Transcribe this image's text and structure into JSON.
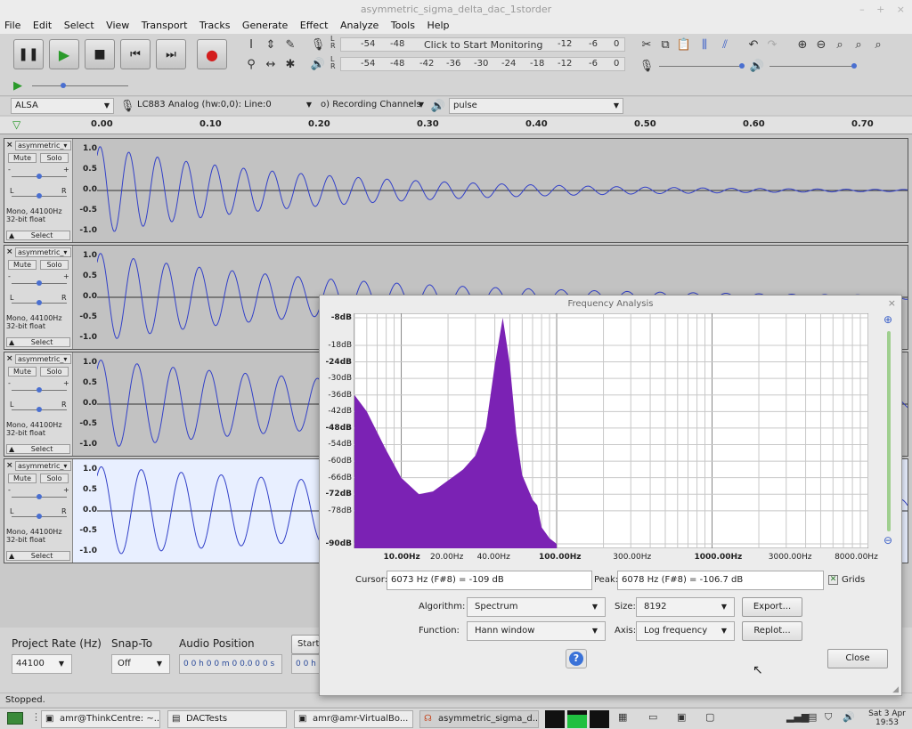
{
  "window": {
    "title": "asymmetric_sigma_delta_dac_1storder",
    "controls": [
      "–",
      "+",
      "×"
    ]
  },
  "menu": [
    "File",
    "Edit",
    "Select",
    "View",
    "Transport",
    "Tracks",
    "Generate",
    "Effect",
    "Analyze",
    "Tools",
    "Help"
  ],
  "meters": {
    "record_row": [
      "-54",
      "-48",
      "Click to Start Monitoring",
      "-12",
      "-6",
      "0"
    ],
    "play_row": [
      "-54",
      "-48",
      "-42",
      "-36",
      "-30",
      "-24",
      "-18",
      "-12",
      "-6",
      "0"
    ],
    "lr": [
      "L",
      "R"
    ]
  },
  "devices": {
    "host": "ALSA",
    "input": "LC883 Analog (hw:0,0): Line:0",
    "channels": "o) Recording Channels",
    "output": "pulse"
  },
  "ruler": {
    "ticks": [
      "0.00",
      "0.10",
      "0.20",
      "0.30",
      "0.40",
      "0.50",
      "0.60",
      "0.70"
    ]
  },
  "tracks": [
    {
      "name": "asymmetric_",
      "mute": "Mute",
      "solo": "Solo",
      "info1": "Mono, 44100Hz",
      "info2": "32-bit float",
      "select": "Select",
      "scale": [
        "1.0",
        "0.5",
        "0.0",
        "-0.5",
        "-1.0"
      ]
    },
    {
      "name": "asymmetric_",
      "mute": "Mute",
      "solo": "Solo",
      "info1": "Mono, 44100Hz",
      "info2": "32-bit float",
      "select": "Select",
      "scale": [
        "1.0",
        "0.5",
        "0.0",
        "-0.5",
        "-1.0"
      ]
    },
    {
      "name": "asymmetric_",
      "mute": "Mute",
      "solo": "Solo",
      "info1": "Mono, 44100Hz",
      "info2": "32-bit float",
      "select": "Select",
      "scale": [
        "1.0",
        "0.5",
        "0.0",
        "-0.5",
        "-1.0"
      ]
    },
    {
      "name": "asymmetric_",
      "mute": "Mute",
      "solo": "Solo",
      "info1": "Mono, 44100Hz",
      "info2": "32-bit float",
      "select": "Select",
      "scale": [
        "1.0",
        "0.5",
        "0.0",
        "-0.5",
        "-1.0"
      ]
    }
  ],
  "dialog": {
    "title": "Frequency Analysis",
    "db_labels": [
      "-8dB",
      "-18dB",
      "-24dB",
      "-30dB",
      "-36dB",
      "-42dB",
      "-48dB",
      "-54dB",
      "-60dB",
      "-66dB",
      "-72dB",
      "-78dB",
      "-90dB"
    ],
    "hz_labels": [
      "10.00Hz",
      "20.00Hz",
      "40.00Hz",
      "100.00Hz",
      "300.00Hz",
      "1000.00Hz",
      "3000.00Hz",
      "8000.00Hz"
    ],
    "cursor_label": "Cursor:",
    "cursor_value": "6073 Hz (F#8) = -109 dB",
    "peak_label": "Peak:",
    "peak_value": "6078 Hz (F#8) = -106.7 dB",
    "grids_label": "Grids",
    "algorithm_label": "Algorithm:",
    "algorithm_value": "Spectrum",
    "size_label": "Size:",
    "size_value": "8192",
    "function_label": "Function:",
    "function_value": "Hann window",
    "axis_label": "Axis:",
    "axis_value": "Log frequency",
    "export_label": "Export...",
    "replot_label": "Replot...",
    "close_label": "Close",
    "help_label": "?"
  },
  "bottom": {
    "project_rate_label": "Project Rate (Hz)",
    "project_rate_value": "44100",
    "snap_label": "Snap-To",
    "snap_value": "Off",
    "audio_pos_label": "Audio Position",
    "audio_pos_value": "0 0 h 0 0 m 0 0.0 0 0 s",
    "start_label": "Start",
    "start_value": "0 0 h"
  },
  "status": "Stopped.",
  "taskbar": {
    "tasks": [
      "amr@ThinkCentre: ~...",
      "DACTests",
      "amr@amr-VirtualBo...",
      "asymmetric_sigma_d..."
    ],
    "clock_date": "Sat 3 Apr",
    "clock_time": "19:53"
  },
  "colors": {
    "spectrum": "#7b22b4",
    "waveform": "#3240c8",
    "selected_track": "#e8efff"
  },
  "chart_data": {
    "type": "area",
    "title": "",
    "xlabel": "",
    "ylabel": "",
    "xscale": "log",
    "x": [
      5,
      6,
      8,
      10,
      13,
      16,
      20,
      25,
      30,
      35,
      40,
      45,
      50,
      55,
      60,
      70,
      75,
      80,
      90,
      100
    ],
    "values": [
      -36,
      -42,
      -56,
      -66,
      -72,
      -71,
      -67,
      -63,
      -58,
      -48,
      -25,
      -8,
      -25,
      -50,
      -65,
      -74,
      -76,
      -84,
      -88,
      -90
    ],
    "xlim": [
      5,
      10000
    ],
    "ylim": [
      -90,
      -8
    ],
    "grid": true
  }
}
